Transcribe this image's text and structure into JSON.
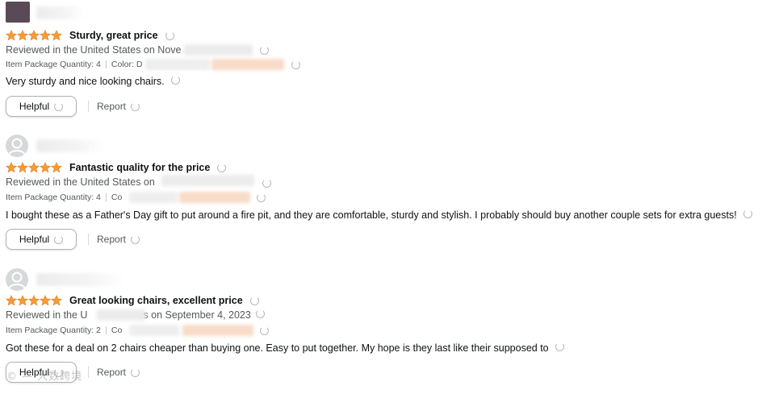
{
  "colors": {
    "star": "#f79b34",
    "star_stroke": "#de7921",
    "text_primary": "#0f1111",
    "text_secondary": "#565959"
  },
  "reviews": [
    {
      "avatar": "profile-avatar-photo",
      "rating": 5,
      "title": "Sturdy, great price",
      "reviewed": "Reviewed in the United States on Nove",
      "qty_label": "Item Package Quantity: 4",
      "color_label": "Color: D",
      "body": "Very sturdy and nice looking chairs.",
      "helpful_label": "Helpful",
      "report_label": "Report"
    },
    {
      "avatar": "default-user-icon",
      "rating": 5,
      "title": "Fantastic quality for the price",
      "reviewed": "Reviewed in the United States on",
      "qty_label": "Item Package Quantity: 4",
      "color_label": "Co",
      "body": "I bought these as a Father's Day gift to put around a fire pit, and they are comfortable, sturdy and stylish. I probably should buy another couple sets for extra guests!",
      "helpful_label": "Helpful",
      "report_label": "Report"
    },
    {
      "avatar": "default-user-icon",
      "rating": 5,
      "title": "Great looking chairs, excellent price",
      "reviewed": "Reviewed in the U",
      "reviewed_tail": "es on September 4, 2023",
      "qty_label": "Item Package Quantity: 2",
      "color_label": "Co",
      "body": "Got these for a deal on 2 chairs cheaper than buying one. Easy to put together. My hope is they last like their supposed to",
      "helpful_label": "Helpful",
      "report_label": "Report"
    }
  ],
  "watermark": "© — 大数跨境"
}
